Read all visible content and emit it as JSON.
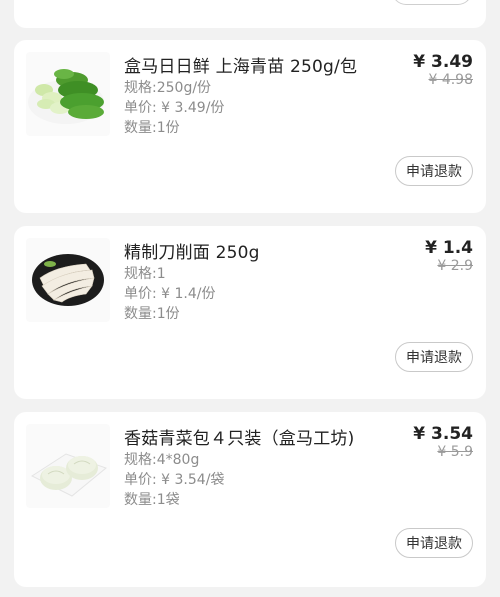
{
  "items": [
    {
      "title": "盒马日日鲜 上海青苗 250g/包",
      "price": "¥ 3.49",
      "original_price": "¥ 4.98",
      "spec": "规格:250g/份",
      "unit_price": "单价: ¥ 3.49/份",
      "quantity": "数量:1份",
      "refund_label": "申请退款",
      "image": "bok-choy-image"
    },
    {
      "title": "精制刀削面 250g",
      "price": "¥ 1.4",
      "original_price": "¥ 2.9",
      "spec": "规格:1",
      "unit_price": "单价: ¥ 1.4/份",
      "quantity": "数量:1份",
      "refund_label": "申请退款",
      "image": "knife-cut-noodles-image"
    },
    {
      "title": "香菇青菜包４只装（盒马工坊)",
      "price": "¥ 3.54",
      "original_price": "¥ 5.9",
      "spec": "规格:4*80g",
      "unit_price": "单价: ¥ 3.54/袋",
      "quantity": "数量:1袋",
      "refund_label": "申请退款",
      "image": "steamed-buns-image"
    }
  ]
}
